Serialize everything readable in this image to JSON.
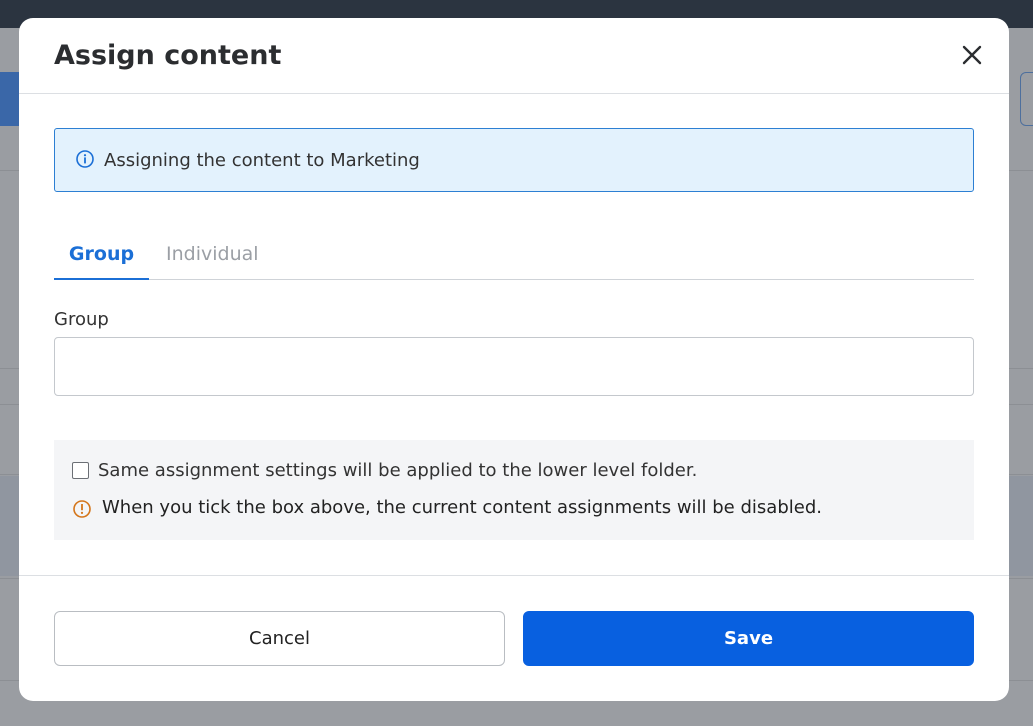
{
  "modal": {
    "title": "Assign content",
    "info_message": "Assigning the content to Marketing",
    "tabs": [
      {
        "label": "Group",
        "active": true
      },
      {
        "label": "Individual",
        "active": false
      }
    ],
    "group_field": {
      "label": "Group",
      "value": "",
      "placeholder": ""
    },
    "options": {
      "apply_lower_level_label": "Same assignment settings will be applied to the lower level folder.",
      "apply_lower_level_checked": false,
      "warning_text": "When you tick the box above, the current content assignments will be disabled."
    },
    "buttons": {
      "cancel_label": "Cancel",
      "save_label": "Save"
    }
  },
  "colors": {
    "accent": "#0860e0",
    "info_background": "#e3f2fd",
    "info_border": "#2c7fd3",
    "warning": "#d4751a"
  },
  "icons": {
    "close": "close-icon",
    "info": "info-icon",
    "warning": "warning-icon"
  }
}
